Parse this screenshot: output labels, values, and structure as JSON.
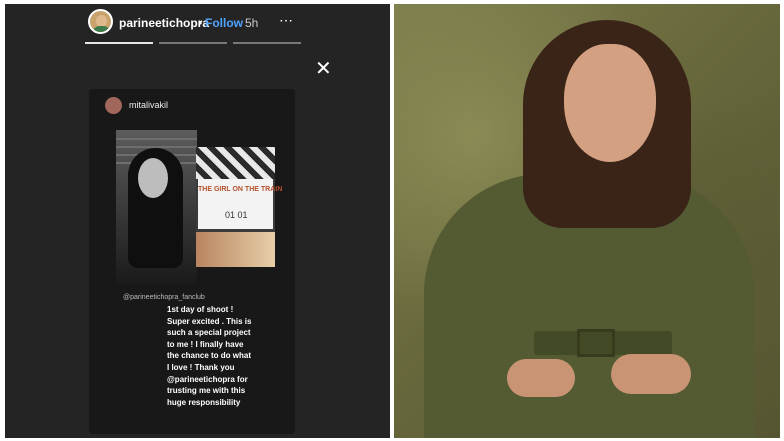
{
  "story": {
    "username": "parineetichopra",
    "separator": "•",
    "follow_label": "Follow",
    "time": "5h",
    "more_icon": "⋯",
    "close_icon": "✕"
  },
  "card": {
    "username": "mitalivakil",
    "slate_title": "THE GIRL ON THE TRAIN",
    "slate_number": "01   01",
    "photo_credit": "@parineetichopra_fanclub",
    "caption_lines": [
      "1st day of shoot !",
      "Super excited . This is",
      "such a special project",
      "to me ! I finally have",
      "the chance to do what",
      "I love ! Thank you",
      "@parineetichopra for",
      "trusting me with this",
      "huge responsibility"
    ]
  },
  "colors": {
    "story_background": "#242424",
    "follow": "#4fa3ff",
    "dress": "#545b33",
    "wall": "#6a6a3e"
  }
}
